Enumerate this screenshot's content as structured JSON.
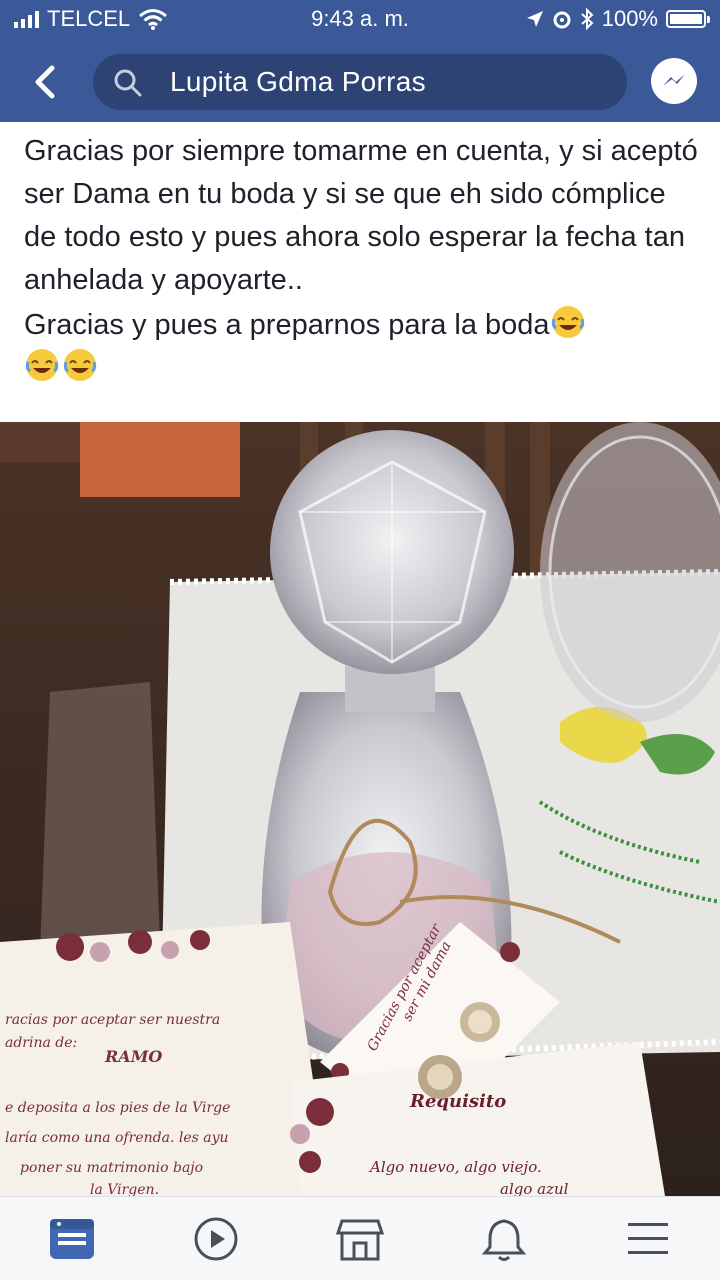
{
  "status_bar": {
    "carrier": "TELCEL",
    "time": "9:43 a. m.",
    "battery_text": "100%",
    "battery_level": 1.0
  },
  "header": {
    "search_text": "Lupita Gdma Porras",
    "back_icon": "chevron-left-icon",
    "messenger_icon": "messenger-icon"
  },
  "post": {
    "paragraph1": "Gracias por siempre tomarme en cuenta, y si aceptó ser Dama en tu boda y si se que eh sido cómplice de todo esto y pues ahora solo esperar la fecha tan anhelada y apoyarte..",
    "paragraph2": "Gracias y pues a preparnos para la boda",
    "emoji": "face-with-tears-of-joy"
  },
  "photo": {
    "card_text": [
      "racias por aceptar ser nuestra",
      "adrina de:",
      "RAMO",
      "e deposita a los pies de la Virge",
      "laría como una ofrenda. les ayu",
      "poner su matrimonio bajo",
      "la Virgen."
    ],
    "tag_text": [
      "Gracias por aceptar",
      "ser mi dama"
    ],
    "card2_text": [
      "Requisito",
      "Algo nuevo, algo viejo.",
      "algo azul"
    ]
  },
  "tabs": [
    {
      "icon": "news-feed-icon",
      "active": true
    },
    {
      "icon": "watch-video-icon",
      "active": false
    },
    {
      "icon": "marketplace-icon",
      "active": false
    },
    {
      "icon": "notifications-bell-icon",
      "active": false
    },
    {
      "icon": "menu-icon",
      "active": false
    }
  ],
  "colors": {
    "brand": "#3b5998",
    "search_bg": "#2d4373",
    "active_tab": "#4267b2",
    "inactive_tab": "#4b4f56"
  }
}
